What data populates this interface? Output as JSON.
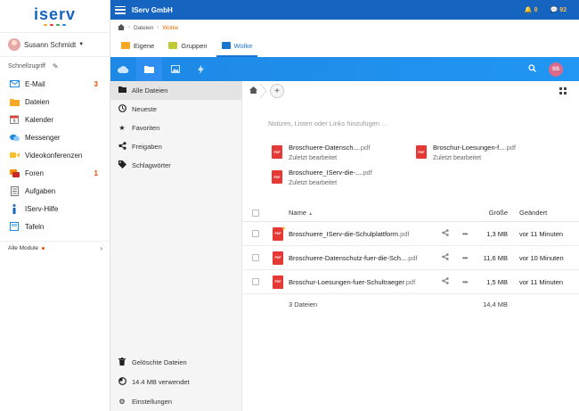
{
  "app": {
    "logo": "iserv",
    "logo_dot_colors": [
      "#f9a825",
      "#e53935",
      "#43a047",
      "#1e88e5"
    ],
    "title": "IServ GmbH",
    "notifications": {
      "alerts": "8",
      "messages": "92"
    },
    "accent_color": "#1565c0"
  },
  "user": {
    "name": "Susann Schmidt",
    "initials": "SS"
  },
  "sidebar": {
    "quick_access": "Schnellzugriff",
    "items": [
      {
        "label": "E-Mail",
        "badge": "3",
        "icon": "mail-icon"
      },
      {
        "label": "Dateien",
        "badge": "",
        "icon": "folder-icon"
      },
      {
        "label": "Kalender",
        "badge": "",
        "icon": "calendar-icon"
      },
      {
        "label": "Messenger",
        "badge": "",
        "icon": "chat-icon"
      },
      {
        "label": "Videokonferenzen",
        "badge": "",
        "icon": "video-icon"
      },
      {
        "label": "Foren",
        "badge": "1",
        "icon": "forum-icon"
      },
      {
        "label": "Aufgaben",
        "badge": "",
        "icon": "tasks-icon"
      },
      {
        "label": "IServ-Hilfe",
        "badge": "",
        "icon": "help-icon"
      },
      {
        "label": "Tafeln",
        "badge": "",
        "icon": "board-icon"
      }
    ],
    "all_modules": "Alle Module"
  },
  "breadcrumb": {
    "root": "Dateien",
    "current": "Wolke"
  },
  "tabs": [
    {
      "label": "Eigene",
      "color": "#f9a825"
    },
    {
      "label": "Gruppen",
      "color": "#c0ca33"
    },
    {
      "label": "Wolke",
      "color": "#1976d2",
      "active": true
    }
  ],
  "files_nav": {
    "items": [
      {
        "label": "Alle Dateien",
        "active": true
      },
      {
        "label": "Neueste"
      },
      {
        "label": "Favoriten"
      },
      {
        "label": "Freigaben"
      },
      {
        "label": "Schlagwörter"
      }
    ],
    "bottom": [
      {
        "label": "Gelöschte Dateien"
      },
      {
        "label": "14.4 MB verwendet"
      },
      {
        "label": "Einstellungen"
      }
    ]
  },
  "main": {
    "notes_placeholder": "Notizen, Listen oder Links hinzufügen …",
    "recent": [
      {
        "name": "Broschuere-Datensch...",
        "ext": ".pdf",
        "sub": "Zuletzt bearbeitet"
      },
      {
        "name": "Broschur-Loesungen-f...",
        "ext": ".pdf",
        "sub": "Zuletzt bearbeitet"
      },
      {
        "name": "Broschuere_IServ-die-...",
        "ext": ".pdf",
        "sub": "Zuletzt bearbeitet"
      }
    ],
    "columns": {
      "name": "Name",
      "size": "Größe",
      "modified": "Geändert"
    },
    "files": [
      {
        "name": "Broschuere_IServ-die-Schulplattform",
        "ext": ".pdf",
        "size": "1,3 MB",
        "modified": "vor 11 Minuten"
      },
      {
        "name": "Broschuere-Datenschutz-fuer-die-Sch...",
        "ext": ".pdf",
        "size": "11,6 MB",
        "modified": "vor 10 Minuten"
      },
      {
        "name": "Broschur-Loesungen-fuer-Schultraeger",
        "ext": ".pdf",
        "size": "1,5 MB",
        "modified": "vor 11 Minuten"
      }
    ],
    "footer": {
      "count": "3 Dateien",
      "total": "14,4 MB"
    },
    "pdf_label": "PDF"
  }
}
